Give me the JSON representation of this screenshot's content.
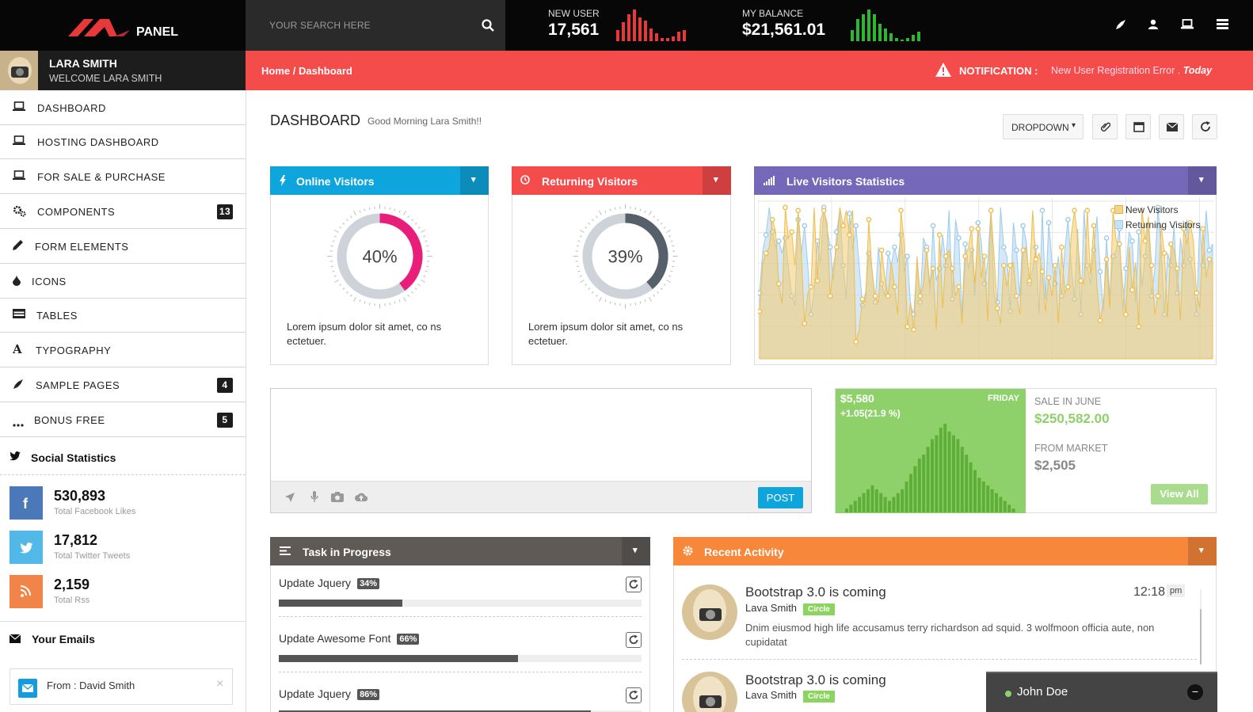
{
  "brand": {
    "logo_text": "PANEL",
    "logo_mark_color": "#e8393a"
  },
  "search": {
    "placeholder": "YOUR SEARCH HERE"
  },
  "stats": [
    {
      "label": "NEW USER",
      "value": "17,561",
      "color": "#e8393a"
    },
    {
      "label": "MY BALANCE",
      "value": "$21,561.01",
      "color": "#2eb82e"
    }
  ],
  "top_icons": [
    "rocket-icon",
    "user-icon",
    "laptop-icon",
    "menu-icon"
  ],
  "profile": {
    "name": "LARA SMITH",
    "welcome": "WELCOME LARA SMITH"
  },
  "breadcrumb": {
    "home": "Home",
    "sep": " / ",
    "current": "Dashboard"
  },
  "notification": {
    "label": "NOTIFICATION :",
    "message": "New User Registration Error .",
    "when": "Today"
  },
  "sidebar": {
    "items": [
      {
        "label": "DASHBOARD",
        "icon": "laptop-icon",
        "badge": ""
      },
      {
        "label": "HOSTING DASHBOARD",
        "icon": "laptop-icon",
        "badge": ""
      },
      {
        "label": "FOR SALE & PURCHASE",
        "icon": "laptop-icon",
        "badge": ""
      },
      {
        "label": "COMPONENTS",
        "icon": "gears-icon",
        "badge": "13"
      },
      {
        "label": "FORM ELEMENTS",
        "icon": "pencil-icon",
        "badge": ""
      },
      {
        "label": "ICONS",
        "icon": "drop-icon",
        "badge": ""
      },
      {
        "label": "TABLES",
        "icon": "table-icon",
        "badge": ""
      },
      {
        "label": "TYPOGRAPHY",
        "icon": "font-icon",
        "badge": ""
      },
      {
        "label": "SAMPLE PAGES",
        "icon": "rocket-icon",
        "badge": "4"
      },
      {
        "label": "BONUS FREE",
        "icon": "ellipsis-icon",
        "badge": "5"
      }
    ],
    "social_title": "Social Statistics",
    "social": [
      {
        "value": "530,893",
        "label": "Total Facebook Likes",
        "color": "#4a78b8",
        "icon": "facebook-icon"
      },
      {
        "value": "17,812",
        "label": "Total Twitter Tweets",
        "color": "#52b8e8",
        "icon": "twitter-icon"
      },
      {
        "value": "2,159",
        "label": "Total Rss",
        "color": "#f08449",
        "icon": "rss-icon"
      }
    ],
    "emails_title": "Your Emails",
    "email_from": "From : David Smith"
  },
  "page": {
    "title": "DASHBOARD",
    "greeting": "Good Morning Lara Smith!!",
    "dropdown": "DROPDOWN"
  },
  "widgets": {
    "online": {
      "title": "Online Visitors",
      "value": "40%",
      "percent": 40,
      "text": "Lorem ipsum dolor sit amet, co ns ectetuer.",
      "color": "#0ea5dc",
      "arc": "#e91e7a"
    },
    "returning": {
      "title": "Returning Visitors",
      "value": "39%",
      "percent": 39,
      "text": "Lorem ipsum dolor sit amet, co ns ectetuer.",
      "color": "#f44b4b",
      "arc": "#56606b"
    },
    "live": {
      "title": "Live Visitors Statistics",
      "color": "#7668b8",
      "legend": [
        "New Visitors",
        "Returning Visitors"
      ]
    }
  },
  "chart_data": {
    "type": "area",
    "series": [
      {
        "name": "New Visitors",
        "values": [
          30,
          62,
          68,
          72,
          90,
          82,
          48,
          35,
          98,
          78,
          82,
          60,
          96,
          68,
          22,
          42,
          46,
          98,
          50,
          90,
          96,
          88,
          40,
          60,
          72,
          98,
          86,
          96,
          80,
          96,
          10,
          18,
          38,
          36,
          90,
          56,
          40,
          36,
          70,
          52,
          40,
          62,
          46,
          28,
          96,
          75,
          20,
          36,
          18,
          66,
          40,
          48,
          70,
          48,
          58,
          18,
          80,
          32,
          66,
          70,
          58,
          40,
          46,
          22,
          66,
          72,
          84,
          48,
          84,
          52,
          66,
          24,
          96,
          66,
          32,
          22,
          60,
          46,
          60,
          62,
          40,
          28,
          70,
          72,
          50,
          96,
          64,
          68,
          56,
          30,
          52,
          40,
          60,
          22,
          72,
          42,
          46,
          80,
          96,
          78,
          50,
          48,
          96,
          54,
          86,
          46,
          24,
          36,
          64,
          32,
          96,
          76,
          74,
          48,
          28,
          72,
          44,
          62,
          20,
          98,
          76,
          92,
          60,
          28,
          40,
          86,
          68,
          26,
          74,
          70,
          58,
          24,
          84,
          74,
          88,
          76,
          42,
          32,
          84,
          52,
          64,
          62
        ]
      },
      {
        "name": "Returning Visitors",
        "values": [
          42,
          70,
          80,
          98,
          82,
          72,
          76,
          68,
          78,
          58,
          40,
          34,
          90,
          68,
          86,
          60,
          28,
          44,
          76,
          62,
          98,
          84,
          72,
          50,
          82,
          96,
          60,
          38,
          94,
          70,
          86,
          60,
          34,
          42,
          68,
          58,
          36,
          72,
          48,
          40,
          68,
          60,
          72,
          62,
          80,
          56,
          66,
          34,
          28,
          62,
          36,
          78,
          72,
          42,
          86,
          50,
          58,
          80,
          60,
          96,
          38,
          90,
          78,
          28,
          74,
          58,
          70,
          40,
          88,
          76,
          48,
          62,
          96,
          40,
          36,
          98,
          72,
          66,
          30,
          88,
          70,
          40,
          86,
          76,
          48,
          58,
          72,
          28,
          96,
          38,
          88,
          62,
          48,
          66,
          40,
          70,
          90,
          60,
          38,
          84,
          28,
          96,
          60,
          48,
          70,
          92,
          56,
          30,
          78,
          40,
          66,
          70,
          84,
          30,
          58,
          82,
          76,
          36,
          82,
          46,
          66,
          90,
          40,
          58,
          98,
          72,
          28,
          68,
          60,
          86,
          42,
          78,
          60,
          90,
          64,
          54,
          28,
          88,
          60,
          96,
          70,
          74
        ]
      }
    ],
    "ylim": [
      0,
      100
    ],
    "legend_position": "top-right",
    "grid": true
  },
  "post": {
    "button": "POST",
    "placeholder": ""
  },
  "sales": {
    "amount": "$5,580",
    "change": "+1.05(21.9 %)",
    "day": "FRIDAY",
    "sale_label": "SALE IN JUNE",
    "sale_value": "$250,582.00",
    "market_label": "FROM MARKET",
    "market_value": "$2,505",
    "button": "View All",
    "color": "#8ed16a",
    "bars": [
      2,
      4,
      6,
      8,
      10,
      12,
      14,
      12,
      10,
      8,
      6,
      8,
      10,
      12,
      16,
      20,
      24,
      28,
      30,
      34,
      38,
      40,
      44,
      46,
      42,
      40,
      38,
      34,
      30,
      26,
      22,
      18,
      16,
      14,
      12,
      10,
      8,
      6,
      4,
      2
    ]
  },
  "tasks": {
    "title": "Task in Progress",
    "color": "#5f5a56",
    "items": [
      {
        "label": "Update Jquery",
        "pct": "34%",
        "value": 34
      },
      {
        "label": "Update Awesome Font",
        "pct": "66%",
        "value": 66
      },
      {
        "label": "Update Jquery",
        "pct": "86%",
        "value": 86
      }
    ]
  },
  "activity": {
    "title": "Recent Activity",
    "color": "#f7873a",
    "items": [
      {
        "title": "Bootstrap 3.0 is coming",
        "name": "Lava Smith",
        "tag": "Circle",
        "time": "12:18",
        "ampm": "pm",
        "text": "Dnim eiusmod high life accusamus terry richardson ad squid. 3 wolfmoon officia aute, non cupidatat"
      },
      {
        "title": "Bootstrap 3.0 is coming",
        "name": "Lava Smith",
        "tag": "Circle"
      }
    ]
  },
  "chat": {
    "user": "John Doe"
  }
}
